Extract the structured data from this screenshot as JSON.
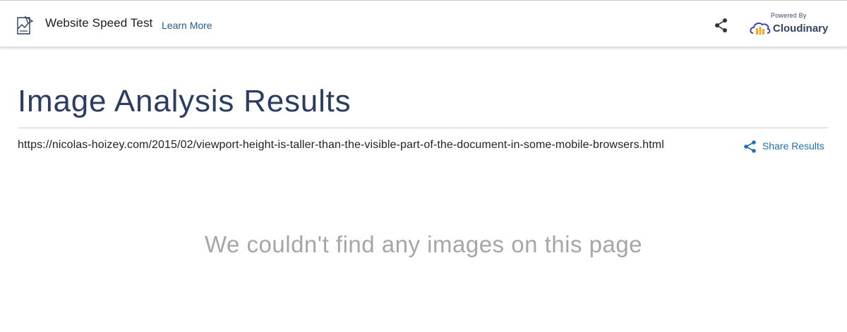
{
  "header": {
    "app_title": "Website Speed Test",
    "learn_more": "Learn More",
    "share_icon": "share-icon",
    "powered_by": "Powered By",
    "brand_name": "Cloudinary",
    "logo_icon": "speed-test-logo-icon",
    "brand_icon": "cloudinary-cloud-icon"
  },
  "main": {
    "title": "Image Analysis Results",
    "url": "https://nicolas-hoizey.com/2015/02/viewport-height-is-taller-than-the-visible-part-of-the-document-in-some-mobile-browsers.html",
    "share_results": "Share Results",
    "empty_message": "We couldn't find any images on this page"
  },
  "colors": {
    "title": "#2b3d63",
    "link": "#1f6fb2",
    "muted_text": "#a6a6a6",
    "brand_orange": "#f5a623",
    "brand_blue": "#3448c5"
  }
}
